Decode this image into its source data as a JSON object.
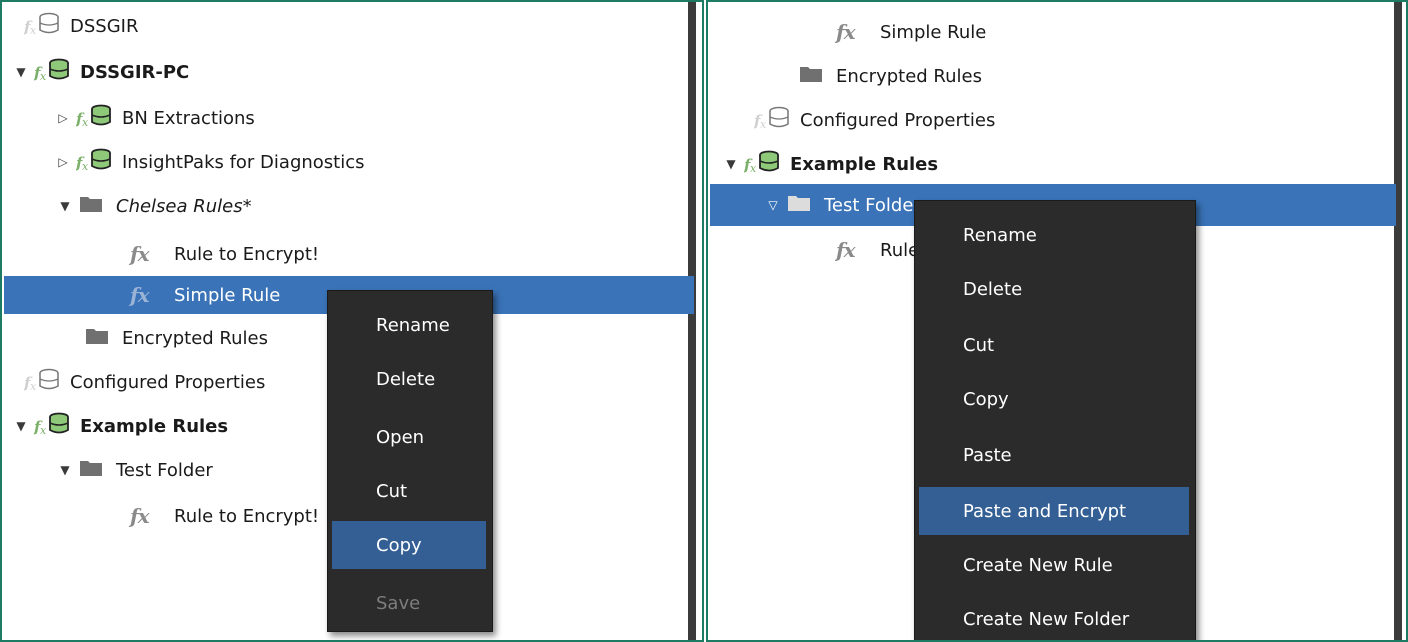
{
  "left_panel": {
    "tree": [
      {
        "label": "DSSGIR",
        "icon": "rule-db-icon",
        "style": "normal",
        "caret": ""
      },
      {
        "label": "DSSGIR-PC",
        "icon": "rule-db-icon-green",
        "style": "bold",
        "caret": "expanded"
      },
      {
        "label": "BN Extractions",
        "icon": "rule-db-icon-green",
        "style": "normal",
        "caret": "collapsed"
      },
      {
        "label": "InsightPaks for Diagnostics",
        "icon": "rule-db-icon-green",
        "style": "normal",
        "caret": "collapsed"
      },
      {
        "label": "Chelsea Rules*",
        "icon": "folder-icon",
        "style": "italic",
        "caret": "expanded"
      },
      {
        "label": "Rule to Encrypt!",
        "icon": "fx-icon",
        "style": "normal",
        "caret": ""
      },
      {
        "label": "Simple Rule",
        "icon": "fx-icon",
        "style": "normal",
        "caret": "",
        "selected": true
      },
      {
        "label": "Encrypted Rules",
        "icon": "folder-icon",
        "style": "normal",
        "caret": ""
      },
      {
        "label": "Configured Properties",
        "icon": "rule-db-icon",
        "style": "normal",
        "caret": ""
      },
      {
        "label": "Example Rules",
        "icon": "rule-db-icon-green",
        "style": "bold",
        "caret": "expanded"
      },
      {
        "label": "Test Folder",
        "icon": "folder-icon",
        "style": "normal",
        "caret": "expanded"
      },
      {
        "label": "Rule to Encrypt!",
        "icon": "fx-icon",
        "style": "normal",
        "caret": ""
      }
    ],
    "context_menu": {
      "items": [
        {
          "label": "Rename",
          "state": "normal"
        },
        {
          "label": "Delete",
          "state": "normal"
        },
        {
          "label": "Open",
          "state": "normal"
        },
        {
          "label": "Cut",
          "state": "normal"
        },
        {
          "label": "Copy",
          "state": "highlighted"
        },
        {
          "label": "Save",
          "state": "disabled"
        }
      ]
    }
  },
  "right_panel": {
    "tree": [
      {
        "label": "Simple Rule",
        "icon": "fx-icon",
        "style": "normal",
        "caret": ""
      },
      {
        "label": "Encrypted Rules",
        "icon": "folder-icon",
        "style": "normal",
        "caret": ""
      },
      {
        "label": "Configured Properties",
        "icon": "rule-db-icon",
        "style": "normal",
        "caret": ""
      },
      {
        "label": "Example Rules",
        "icon": "rule-db-icon-green",
        "style": "bold",
        "caret": "expanded"
      },
      {
        "label": "Test Folder",
        "icon": "folder-icon",
        "style": "normal",
        "caret": "expanded-outline",
        "selected": true
      },
      {
        "label": "Rule to Encrypt!",
        "icon": "fx-icon",
        "style": "normal",
        "caret": ""
      }
    ],
    "context_menu": {
      "items": [
        {
          "label": "Rename",
          "state": "normal"
        },
        {
          "label": "Delete",
          "state": "normal"
        },
        {
          "label": "Cut",
          "state": "normal"
        },
        {
          "label": "Copy",
          "state": "normal"
        },
        {
          "label": "Paste",
          "state": "normal"
        },
        {
          "label": "Paste and Encrypt",
          "state": "highlighted"
        },
        {
          "label": "Create New Rule",
          "state": "normal"
        },
        {
          "label": "Create New Folder",
          "state": "normal"
        }
      ]
    }
  },
  "colors": {
    "selection": "#3a73b8",
    "menu_background": "#2b2b2b",
    "menu_highlight": "#335f95",
    "panel_border": "#1e7b63",
    "db_icon_green": "#8ec97a",
    "folder_gray": "#707070"
  }
}
